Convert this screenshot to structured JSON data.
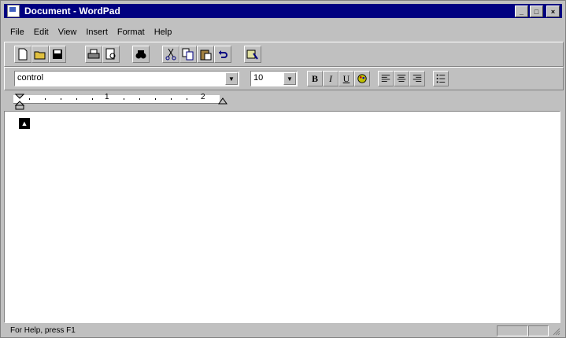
{
  "window": {
    "title": "Document - WordPad",
    "caption_buttons": {
      "minimize": "_",
      "maximize": "□",
      "close": "×"
    }
  },
  "menu": [
    "File",
    "Edit",
    "View",
    "Insert",
    "Format",
    "Help"
  ],
  "toolbar": {
    "icons": [
      "new-document-icon",
      "open-folder-icon",
      "save-disk-icon",
      "print-icon",
      "print-preview-icon",
      "find-binoculars-icon",
      "cut-scissors-icon",
      "copy-icon",
      "paste-icon",
      "undo-icon",
      "insert-datetime-icon"
    ]
  },
  "format_bar": {
    "font_value": "control",
    "size_value": "10",
    "bold": "B",
    "italic": "I",
    "underline": "U"
  },
  "ruler": {
    "numbers": [
      "1",
      "2"
    ]
  },
  "document": {
    "text": ""
  },
  "status": {
    "text": "For Help, press F1"
  }
}
